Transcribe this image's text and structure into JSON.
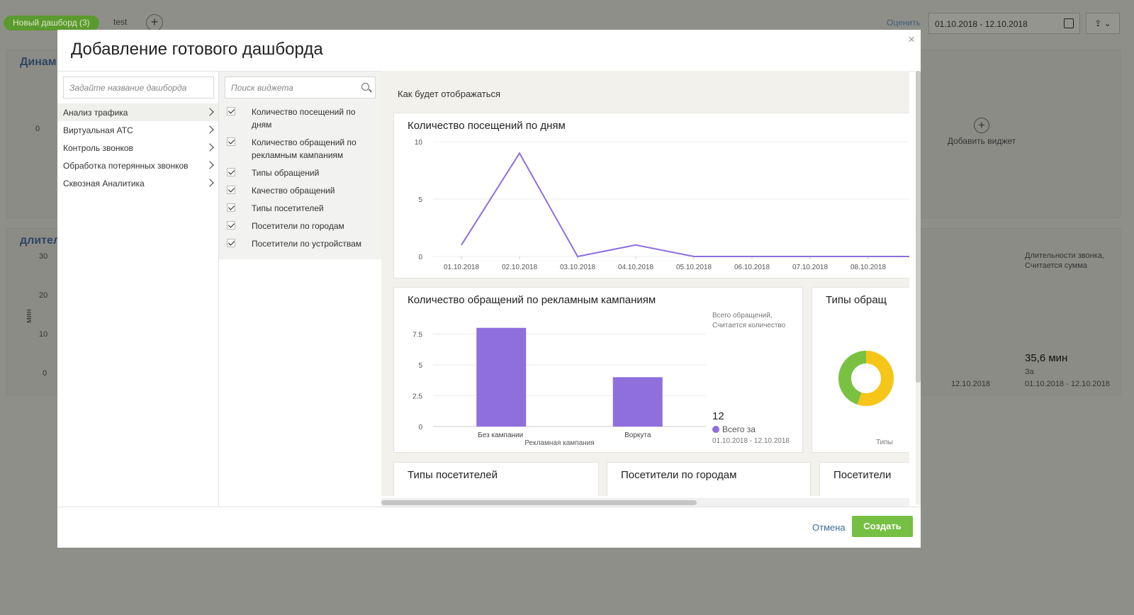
{
  "topbar": {
    "tab_active": "Новый дашборд (3)",
    "tab_test": "test",
    "add_tab": "+",
    "rate_link": "Оценить",
    "date_range": "01.10.2018 - 12.10.2018"
  },
  "background": {
    "panel1_title": "Динам",
    "panel1_ytick": "0",
    "panel2_title": "длител",
    "panel2_yticks": [
      "30",
      "20",
      "10",
      "0"
    ],
    "panel2_ylabel": "мин",
    "add_widget": "Добавить виджет",
    "legend_text": "Длительности звонка, Считается сумма",
    "big_value": "35,6 мин",
    "period_label": "За",
    "period": "01.10.2018 - 12.10.2018",
    "x_tick": "12.10.2018"
  },
  "modal": {
    "title": "Добавление готового дашборда",
    "close": "×",
    "name_placeholder": "Задайте название дашборда",
    "search_placeholder": "Поиск виджета",
    "categories": [
      "Анализ трафика",
      "Виртуальная АТС",
      "Контроль звонков",
      "Обработка потерянных звонков",
      "Сквозная Аналитика"
    ],
    "widgets": [
      "Количество посещений по дням",
      "Количество обращений по рекламным кампаниям",
      "Типы обращений",
      "Качество обращений",
      "Типы посетителей",
      "Посетители по городам",
      "Посетители по устройствам"
    ],
    "preview_label": "Как будет отображаться",
    "cancel": "Отмена",
    "create": "Создать"
  },
  "preview": {
    "card_visits_title": "Количество посещений по дням",
    "card_campaigns_title": "Количество обращений по рекламным кампаниям",
    "card_types_title": "Типы обращ",
    "card_types_sub": "Типы",
    "card_visitors_title": "Типы посетителей",
    "card_cities_title": "Посетители по городам",
    "card_devices_title": "Посетители",
    "campaign_legend": "Всего обращений, Считается количество",
    "campaign_total": "12",
    "campaign_total_label": "Всего за",
    "campaign_period": "01.10.2018 - 12.10.2018"
  },
  "colors": {
    "accent_green": "#75c043",
    "series_purple": "#8e6fdc",
    "donut_green": "#7ac142",
    "donut_yellow": "#f5c518"
  },
  "chart_data": [
    {
      "type": "line",
      "title": "Количество посещений по дням",
      "x": [
        "01.10.2018",
        "02.10.2018",
        "03.10.2018",
        "04.10.2018",
        "05.10.2018",
        "06.10.2018",
        "07.10.2018",
        "08.10.2018"
      ],
      "values": [
        1,
        9,
        0,
        1,
        0,
        0,
        0,
        0
      ],
      "yticks": [
        "0",
        "5",
        "10"
      ],
      "ylim": [
        0,
        10
      ],
      "grid": true
    },
    {
      "type": "bar",
      "title": "Количество обращений по рекламным кампаниям",
      "categories": [
        "Без кампании",
        "Воркута"
      ],
      "values": [
        8,
        4
      ],
      "xlabel": "Рекламная кампания",
      "yticks": [
        "0",
        "2.5",
        "5",
        "7.5"
      ],
      "ylim": [
        0,
        8.5
      ],
      "grid": true
    },
    {
      "type": "pie",
      "title": "Типы обращ",
      "values": [
        0.55,
        0.45
      ],
      "colors": [
        "#f5c518",
        "#7ac142"
      ]
    }
  ]
}
